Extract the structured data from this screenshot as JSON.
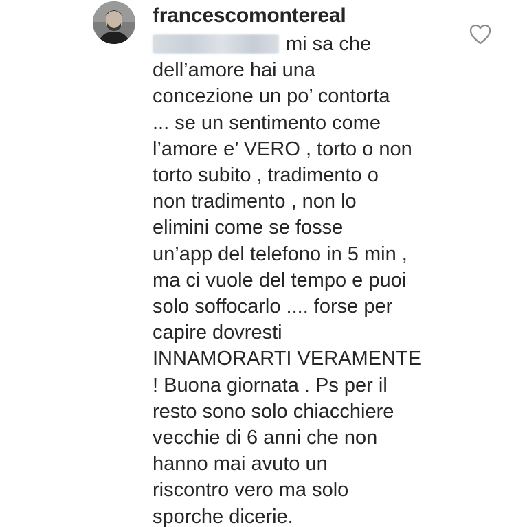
{
  "comment": {
    "username": "francescomontereal",
    "avatar_icon": "profile-photo",
    "like_icon": "heart-outline-icon",
    "mention_blurred": true,
    "lines": [
      "mi sa che",
      "dell’amore hai una",
      "concezione un po’ contorta",
      "... se un sentimento come",
      "l’amore e’ VERO , torto o non",
      "torto subito , tradimento o",
      "non tradimento , non lo",
      "elimini come se fosse",
      "un’app del telefono in 5 min ,",
      "ma ci vuole del tempo e puoi",
      "solo soffocarlo .... forse per",
      "capire dovresti",
      "INNAMORARTI VERAMENTE",
      "! Buona giornata . Ps per il",
      "resto sono solo chiacchiere",
      "vecchie di 6 anni che non",
      "hanno mai avuto un",
      "riscontro vero ma solo",
      "sporche dicerie."
    ]
  }
}
